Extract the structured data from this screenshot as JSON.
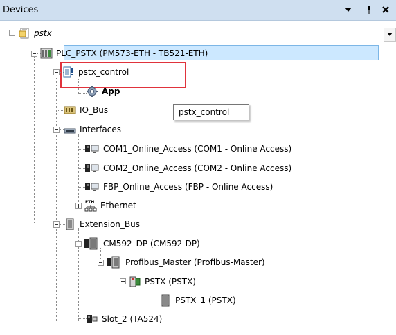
{
  "panel": {
    "title": "Devices",
    "menu_glyph": "▾",
    "pin_glyph": "ᵖ",
    "close_glyph": "✕",
    "dropdown_glyph": "▼"
  },
  "tree": {
    "root": "pstx",
    "plc": "PLC_PSTX (PM573-ETH - TB521-ETH)",
    "control": "pstx_control",
    "app": "App",
    "io_bus": "IO_Bus",
    "interfaces": "Interfaces",
    "com1": "COM1_Online_Access (COM1 - Online Access)",
    "com2": "COM2_Online_Access (COM2 - Online Access)",
    "fbp": "FBP_Online_Access (FBP - Online Access)",
    "ethernet": "Ethernet",
    "extension_bus": "Extension_Bus",
    "cm592": "CM592_DP (CM592-DP)",
    "profibus_master": "Profibus_Master (Profibus-Master)",
    "pstx_slave": "PSTX (PSTX)",
    "pstx_1": "PSTX_1 (PSTX)",
    "slot2": "Slot_2 (TA524)"
  },
  "tooltip": {
    "text": "pstx_control"
  },
  "icons": {
    "project": "project-icon",
    "plc": "plc-icon",
    "application": "application-icon",
    "app_gear": "gear-icon",
    "bus": "bus-icon",
    "interface": "interface-icon",
    "online_access": "online-access-icon",
    "ethernet": "ethernet-icon",
    "module": "module-icon",
    "slave": "slave-icon"
  },
  "colors": {
    "titlebar": "#cfdff0",
    "selection": "#cce8ff",
    "selection_border": "#7cb6e6",
    "highlight_box": "#e0333c"
  }
}
